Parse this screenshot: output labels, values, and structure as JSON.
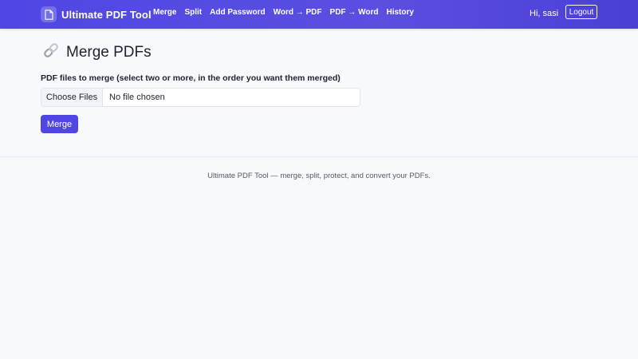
{
  "brand": {
    "name": "Ultimate PDF Tool",
    "icon": "document-icon"
  },
  "nav": {
    "links": [
      "Merge",
      "Split",
      "Add Password",
      "Word → PDF",
      "PDF → Word",
      "History"
    ]
  },
  "user": {
    "greeting": "Hi, sasi",
    "logout_label": "Logout"
  },
  "page": {
    "title": "Merge PDFs",
    "title_icon": "link-icon"
  },
  "form": {
    "label": "PDF files to merge (select two or more, in the order you want them merged)",
    "choose_files_label": "Choose Files",
    "file_status": "No file chosen",
    "submit_label": "Merge"
  },
  "footer": {
    "text": "Ultimate PDF Tool — merge, split, protect, and convert your PDFs."
  },
  "colors": {
    "nav_bg": "#4f46e5",
    "accent": "#4f46e5",
    "page_bg": "#f8f9fc"
  }
}
